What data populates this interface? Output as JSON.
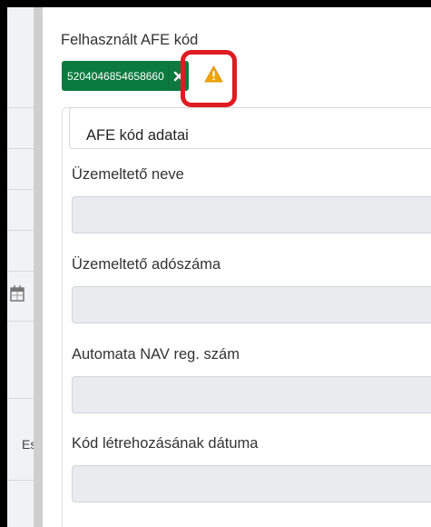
{
  "background": {
    "partial_text": "Es"
  },
  "dialog": {
    "title": "Felhasznált AFE kód",
    "chip": {
      "code": "5204046854658660",
      "remove_symbol": "✕"
    },
    "warning_icon": "warning-triangle-icon",
    "section": {
      "legend": "AFE kód adatai",
      "fields": [
        {
          "label": "Üzemeltető neve",
          "value": ""
        },
        {
          "label": "Üzemeltető adószáma",
          "value": ""
        },
        {
          "label": "Automata NAV reg. szám",
          "value": ""
        },
        {
          "label": "Kód létrehozásának dátuma",
          "value": ""
        }
      ]
    }
  },
  "colors": {
    "chip_green": "#0b7a3e",
    "warning": "#f0a500",
    "highlight_red": "#e01b22",
    "input_disabled": "#e9ecef"
  }
}
